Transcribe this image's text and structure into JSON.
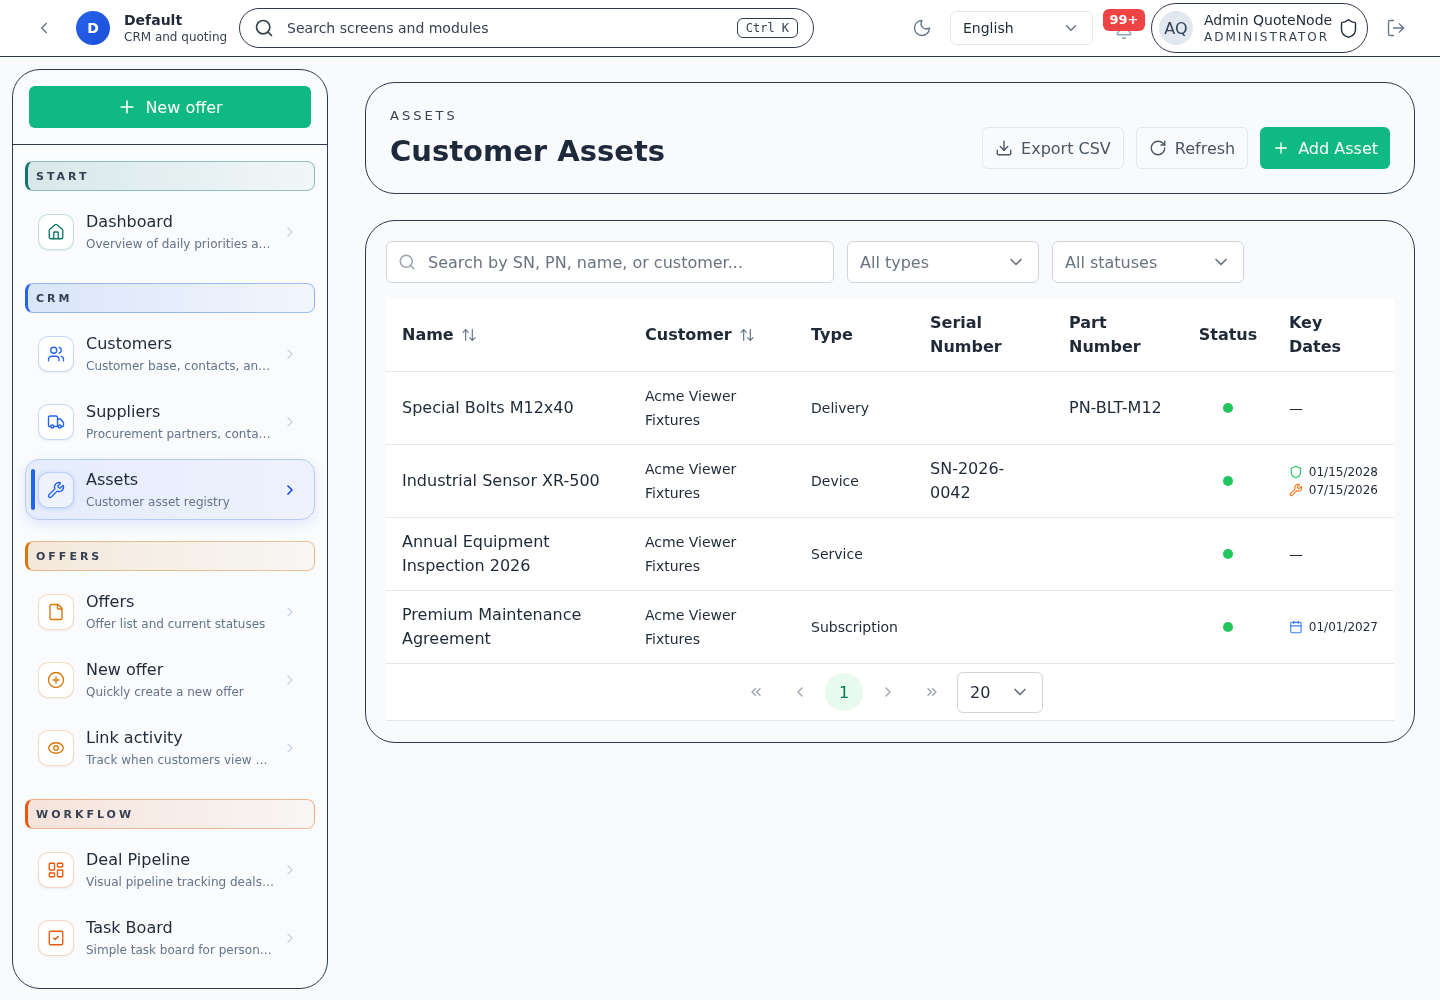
{
  "topbar": {
    "workspace": {
      "initial": "D",
      "name": "Default",
      "subtitle": "CRM and quoting"
    },
    "search": {
      "placeholder": "Search screens and modules",
      "shortcut": "Ctrl K"
    },
    "language": "English",
    "notification_count": "99+",
    "user": {
      "initials": "AQ",
      "name": "Admin QuoteNode",
      "role": "ADMINISTRATOR"
    }
  },
  "sidebar": {
    "new_offer_button": "New offer",
    "sections": [
      {
        "title": "START",
        "color": "#0f766e",
        "items": [
          {
            "label": "Dashboard",
            "description": "Overview of daily priorities a…",
            "selected": false
          }
        ]
      },
      {
        "title": "CRM",
        "color": "#2563eb",
        "items": [
          {
            "label": "Customers",
            "description": "Customer base, contacts, an…",
            "selected": false
          },
          {
            "label": "Suppliers",
            "description": "Procurement partners, conta…",
            "selected": false
          },
          {
            "label": "Assets",
            "description": "Customer asset registry",
            "selected": true
          }
        ]
      },
      {
        "title": "OFFERS",
        "color": "#d97706",
        "items": [
          {
            "label": "Offers",
            "description": "Offer list and current statuses",
            "selected": false
          },
          {
            "label": "New offer",
            "description": "Quickly create a new offer",
            "selected": false
          },
          {
            "label": "Link activity",
            "description": "Track when customers view …",
            "selected": false
          }
        ]
      },
      {
        "title": "WORKFLOW",
        "color": "#ea580c",
        "items": [
          {
            "label": "Deal Pipeline",
            "description": "Visual pipeline tracking deals…",
            "selected": false
          },
          {
            "label": "Task Board",
            "description": "Simple task board for person…",
            "selected": false
          }
        ]
      }
    ]
  },
  "page_header": {
    "eyebrow": "ASSETS",
    "title": "Customer Assets",
    "buttons": [
      {
        "label": "Export CSV",
        "kind": "secondary"
      },
      {
        "label": "Refresh",
        "kind": "secondary"
      },
      {
        "label": "Add Asset",
        "kind": "primary"
      }
    ]
  },
  "filters": {
    "search_placeholder": "Search by SN, PN, name, or customer...",
    "type_select": "All types",
    "status_select": "All statuses"
  },
  "table": {
    "columns": [
      {
        "label": "Name",
        "sortable": true
      },
      {
        "label": "Customer",
        "sortable": true
      },
      {
        "label": "Type",
        "sortable": false
      },
      {
        "label": "Serial Number",
        "sortable": false
      },
      {
        "label": "Part Number",
        "sortable": false
      },
      {
        "label": "Status",
        "sortable": false
      },
      {
        "label": "Key Dates",
        "sortable": false
      }
    ],
    "rows": [
      {
        "name": "Special Bolts M12x40",
        "customer": "Acme Viewer Fixtures",
        "type": "Delivery",
        "part_number": "PN-BLT-M12",
        "status": {
          "color": "#22c55e"
        },
        "key_dates_empty": "—"
      },
      {
        "name": "Industrial Sensor XR-500",
        "customer": "Acme Viewer Fixtures",
        "type": "Device",
        "serial_number": "SN-2026-0042",
        "status": {
          "color": "#22c55e"
        },
        "key_dates": [
          {
            "kind": "warranty",
            "date": "01/15/2028"
          },
          {
            "kind": "maintenance",
            "date": "07/15/2026"
          }
        ]
      },
      {
        "name": "Annual Equipment Inspection 2026",
        "customer": "Acme Viewer Fixtures",
        "type": "Service",
        "status": {
          "color": "#22c55e"
        },
        "key_dates_empty": "—"
      },
      {
        "name": "Premium Maintenance Agreement",
        "customer": "Acme Viewer Fixtures",
        "type": "Subscription",
        "status": {
          "color": "#22c55e"
        },
        "key_dates": [
          {
            "kind": "renewal",
            "date": "01/01/2027"
          }
        ]
      }
    ]
  },
  "pagination": {
    "pages": [
      {
        "label": "1",
        "selected": true
      }
    ],
    "page_size": "20"
  }
}
